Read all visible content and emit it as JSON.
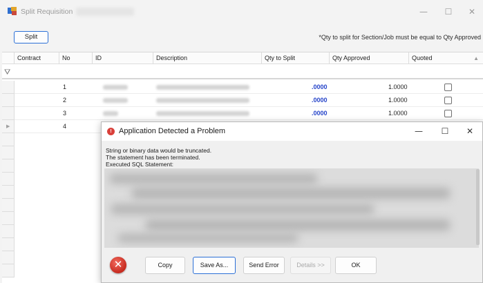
{
  "window": {
    "title": "Split Requisition",
    "controls": {
      "min": "—",
      "max": "☐",
      "close": "✕"
    }
  },
  "toolbar": {
    "split_label": "Split",
    "note": "*Qty to split for Section/Job must be equal to Qty Approved"
  },
  "grid": {
    "columns": [
      "Contract",
      "No",
      "ID",
      "Description",
      "Qty to Split",
      "Qty Approved",
      "Quoted"
    ],
    "rows": [
      {
        "no": "1",
        "qty_to_split": ".0000",
        "qty_approved": "1.0000",
        "quoted": false
      },
      {
        "no": "2",
        "qty_to_split": ".0000",
        "qty_approved": "1.0000",
        "quoted": false
      },
      {
        "no": "3",
        "qty_to_split": ".0000",
        "qty_approved": "1.0000",
        "quoted": false
      },
      {
        "no": "4"
      }
    ]
  },
  "dialog": {
    "title": "Application Detected a Problem",
    "message_lines": [
      "String or binary data would be truncated.",
      "The statement has been terminated.",
      "Executed SQL Statement:"
    ],
    "buttons": {
      "copy": "Copy",
      "save_as": "Save As...",
      "send_error": "Send Error",
      "details": "Details >>",
      "ok": "OK"
    }
  },
  "colors": {
    "accent": "#2b6fd6",
    "qty_split": "#2443c9",
    "error": "#d9403a"
  },
  "icons": [
    "app-icon",
    "filter-icon",
    "row-pointer-icon",
    "sort-caret-icon",
    "error-icon",
    "error-large-icon"
  ]
}
